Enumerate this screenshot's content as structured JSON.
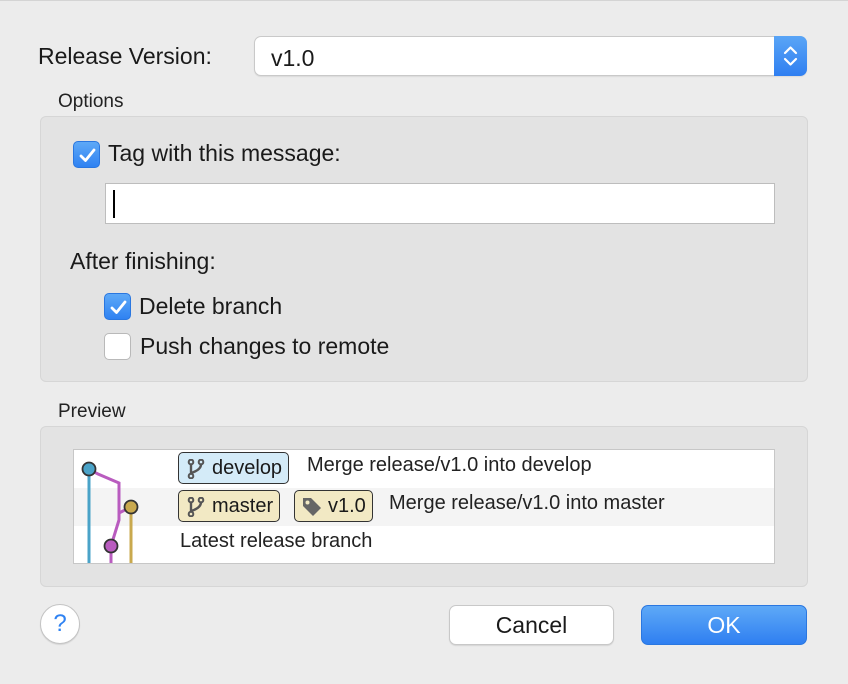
{
  "release": {
    "label": "Release Version:",
    "value": "v1.0"
  },
  "options": {
    "group_label": "Options",
    "tag_message": {
      "label": "Tag with this message:",
      "checked": true
    },
    "message_input": {
      "value": "",
      "placeholder": ""
    },
    "after_finishing_label": "After finishing:",
    "delete_branch": {
      "label": "Delete branch",
      "checked": true
    },
    "push_changes": {
      "label": "Push changes to remote",
      "checked": false
    }
  },
  "preview": {
    "group_label": "Preview",
    "rows": [
      {
        "badges": [
          {
            "label": "develop",
            "type": "branch"
          }
        ],
        "message": "Merge release/v1.0 into develop"
      },
      {
        "badges": [
          {
            "label": "master",
            "type": "branch"
          },
          {
            "label": "v1.0",
            "type": "tag"
          }
        ],
        "message": "Merge release/v1.0 into master"
      },
      {
        "badges": [],
        "message": "Latest release branch"
      }
    ],
    "graph_colors": {
      "develop": "#4aa3c8",
      "merge": "#b95cbf",
      "master": "#c9a94e"
    }
  },
  "buttons": {
    "help": "?",
    "cancel": "Cancel",
    "ok": "OK"
  },
  "icons": {
    "stepper": "up-down-chevron-icon",
    "checkmark": "checkmark-icon",
    "branch": "git-branch-icon",
    "tag": "tag-icon"
  },
  "colors": {
    "accent": "#2f82f2",
    "background": "#ececec"
  }
}
